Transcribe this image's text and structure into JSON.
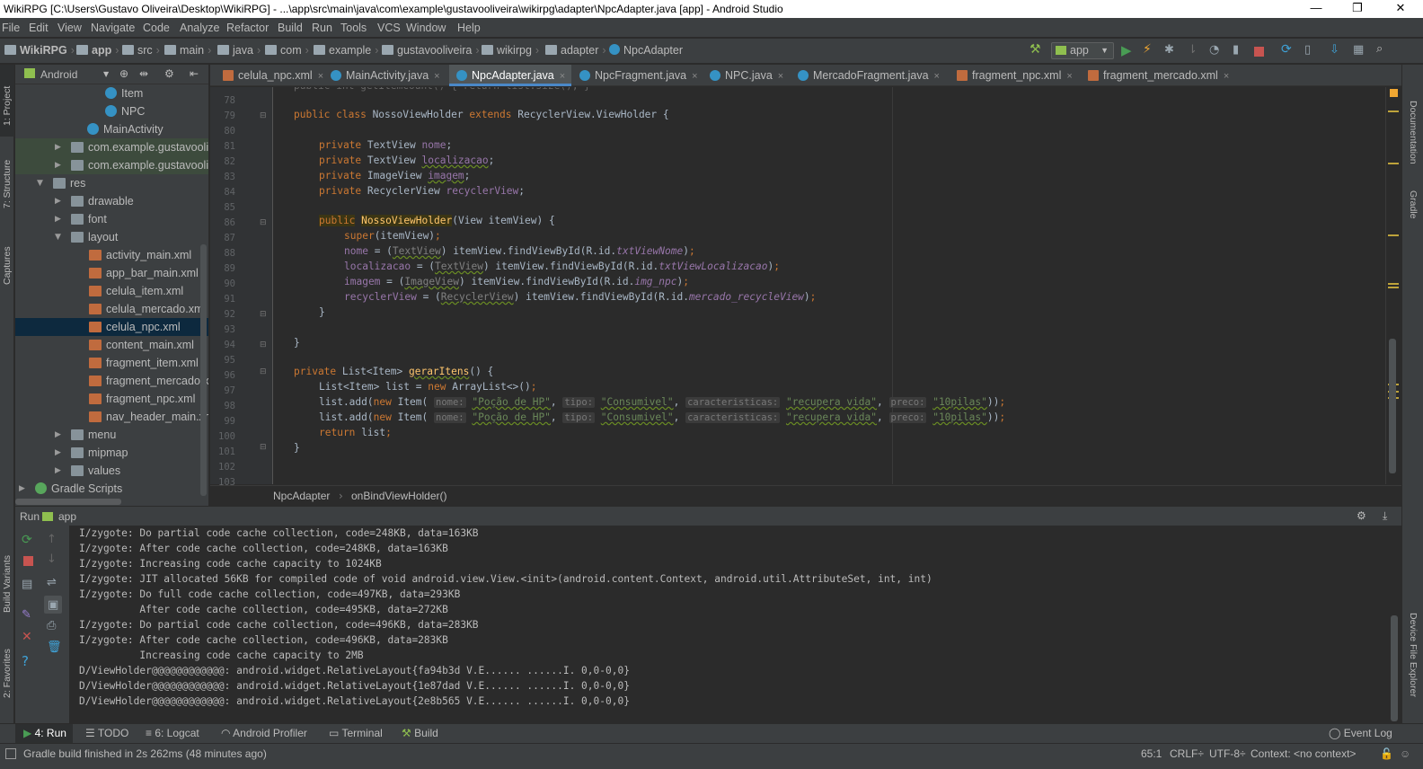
{
  "window": {
    "title": "WikiRPG [C:\\Users\\Gustavo Oliveira\\Desktop\\WikiRPG] - ...\\app\\src\\main\\java\\com\\example\\gustavooliveira\\wikirpg\\adapter\\NpcAdapter.java [app] - Android Studio",
    "minimize": "—",
    "maximize": "❐",
    "close": "✕"
  },
  "menu": [
    "File",
    "Edit",
    "View",
    "Navigate",
    "Code",
    "Analyze",
    "Refactor",
    "Build",
    "Run",
    "Tools",
    "VCS",
    "Window",
    "Help"
  ],
  "breadcrumbs": [
    "WikiRPG",
    "app",
    "src",
    "main",
    "java",
    "com",
    "example",
    "gustavooliveira",
    "wikirpg",
    "adapter",
    "NpcAdapter"
  ],
  "run_config": "app",
  "toolstrip_left": [
    "1: Project",
    "7: Structure",
    "Captures",
    "Build Variants",
    "2: Favorites"
  ],
  "toolstrip_right": [
    "Documentation",
    "Gradle",
    "Device File Explorer"
  ],
  "project": {
    "view": "Android",
    "tree": [
      {
        "label": "Item",
        "type": "class"
      },
      {
        "label": "NPC",
        "type": "class"
      },
      {
        "label": "MainActivity",
        "type": "class"
      },
      {
        "label": "com.example.gustavooliv",
        "type": "folder"
      },
      {
        "label": "com.example.gustavooliv",
        "type": "folder"
      },
      {
        "label": "res",
        "type": "folder"
      },
      {
        "label": "drawable",
        "type": "folder"
      },
      {
        "label": "font",
        "type": "folder"
      },
      {
        "label": "layout",
        "type": "folder"
      },
      {
        "label": "activity_main.xml",
        "type": "xml"
      },
      {
        "label": "app_bar_main.xml",
        "type": "xml"
      },
      {
        "label": "celula_item.xml",
        "type": "xml"
      },
      {
        "label": "celula_mercado.xml",
        "type": "xml"
      },
      {
        "label": "celula_npc.xml",
        "type": "xml"
      },
      {
        "label": "content_main.xml",
        "type": "xml"
      },
      {
        "label": "fragment_item.xml",
        "type": "xml"
      },
      {
        "label": "fragment_mercado.xm",
        "type": "xml"
      },
      {
        "label": "fragment_npc.xml",
        "type": "xml"
      },
      {
        "label": "nav_header_main.xml",
        "type": "xml"
      },
      {
        "label": "menu",
        "type": "folder"
      },
      {
        "label": "mipmap",
        "type": "folder"
      },
      {
        "label": "values",
        "type": "folder"
      },
      {
        "label": "Gradle Scripts",
        "type": "gradle"
      }
    ]
  },
  "tabs": [
    "celula_npc.xml",
    "MainActivity.java",
    "NpcAdapter.java",
    "NpcFragment.java",
    "NPC.java",
    "MercadoFragment.java",
    "fragment_npc.xml",
    "fragment_mercado.xml"
  ],
  "line_numbers": [
    "78",
    "79",
    "80",
    "81",
    "82",
    "83",
    "84",
    "85",
    "86",
    "87",
    "88",
    "89",
    "90",
    "91",
    "92",
    "93",
    "94",
    "95",
    "96",
    "97",
    "98",
    "99",
    "100",
    "101",
    "102",
    "103"
  ],
  "code": {
    "hint_nome": "nome:",
    "hint_tipo": "tipo:",
    "hint_carac": "caracteristicas:",
    "hint_preco": "preco:",
    "str_pocao": "\"Poção de HP\"",
    "str_consumivel": "\"Consumivel\"",
    "str_recupera": "\"recupera vida\"",
    "str_pilas": "\"10pilas\""
  },
  "editor_breadcrumb": [
    "NpcAdapter",
    "onBindViewHolder()"
  ],
  "run_panel": {
    "label": "Run",
    "config": "app",
    "console": [
      "I/zygote: Do partial code cache collection, code=248KB, data=163KB",
      "I/zygote: After code cache collection, code=248KB, data=163KB",
      "I/zygote: Increasing code cache capacity to 1024KB",
      "I/zygote: JIT allocated 56KB for compiled code of void android.view.View.<init>(android.content.Context, android.util.AttributeSet, int, int)",
      "I/zygote: Do full code cache collection, code=497KB, data=293KB",
      "          After code cache collection, code=495KB, data=272KB",
      "I/zygote: Do partial code cache collection, code=496KB, data=283KB",
      "I/zygote: After code cache collection, code=496KB, data=283KB",
      "          Increasing code cache capacity to 2MB",
      "D/ViewHolder@@@@@@@@@@@@: android.widget.RelativeLayout{fa94b3d V.E...... ......I. 0,0-0,0}",
      "D/ViewHolder@@@@@@@@@@@@: android.widget.RelativeLayout{1e87dad V.E...... ......I. 0,0-0,0}",
      "D/ViewHolder@@@@@@@@@@@@: android.widget.RelativeLayout{2e8b565 V.E...... ......I. 0,0-0,0}"
    ]
  },
  "bottom_tools": [
    "4: Run",
    "TODO",
    "6: Logcat",
    "Android Profiler",
    "Terminal",
    "Build",
    "Event Log"
  ],
  "status": {
    "message": "Gradle build finished in 2s 262ms (48 minutes ago)",
    "position": "65:1",
    "line_sep": "CRLF÷",
    "encoding": "UTF-8÷",
    "context": "Context: <no context>"
  },
  "colors": {
    "accent": "#4a88c7",
    "selection": "#0d293e",
    "run_green": "#499c54",
    "stop_red": "#c75450"
  }
}
